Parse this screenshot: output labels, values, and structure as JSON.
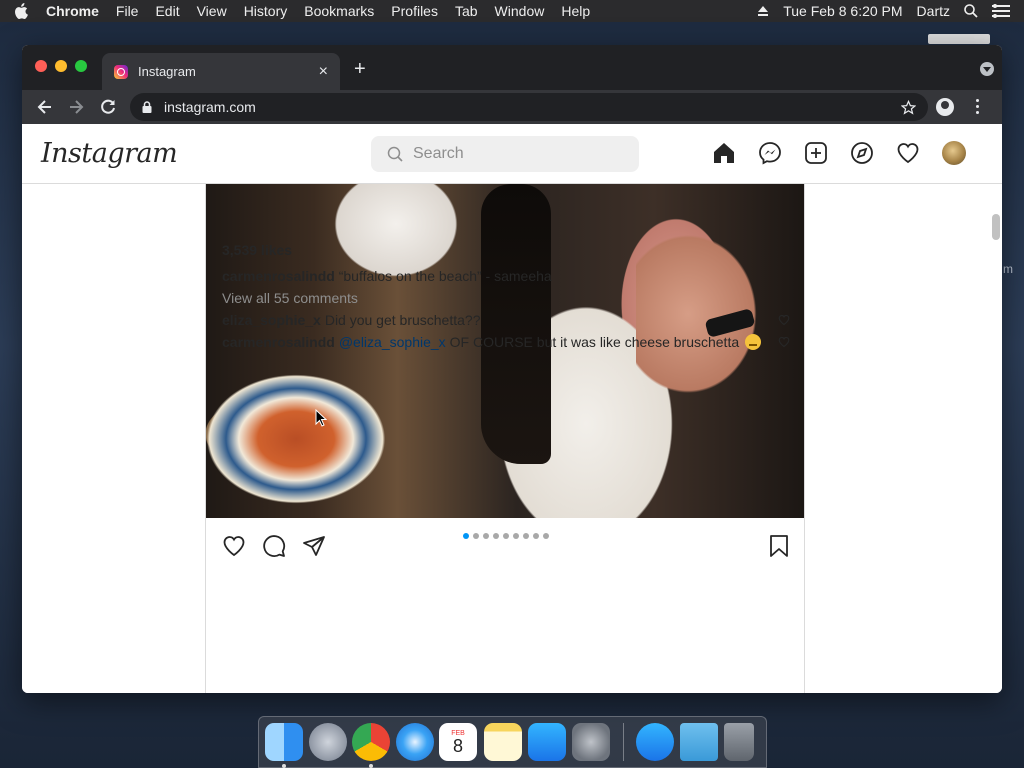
{
  "menubar": {
    "app_name": "Chrome",
    "items": [
      "File",
      "Edit",
      "View",
      "History",
      "Bookmarks",
      "Profiles",
      "Tab",
      "Window",
      "Help"
    ],
    "datetime": "Tue Feb 8  6:20 PM",
    "user": "Dartz"
  },
  "desktop": {
    "edge_text": "m"
  },
  "browser": {
    "tab_title": "Instagram",
    "tab_close": "×",
    "new_tab": "+",
    "url": "instagram.com"
  },
  "instagram": {
    "logo": "Instagram",
    "search_placeholder": "Search",
    "post": {
      "likes": "3,539 likes",
      "caption_user": "carmenrosalindd",
      "caption_text": "“buffalos on the beach” - sameeha",
      "view_all": "View all 55 comments",
      "carousel_count": 9,
      "carousel_active": 0,
      "comments": [
        {
          "user": "eliza_sophie_x",
          "mention": "",
          "text": "Did you get bruschetta??"
        },
        {
          "user": "carmenrosalindd",
          "mention": "@eliza_sophie_x",
          "text": "OF COURSE but it was like cheese bruschetta"
        }
      ]
    }
  },
  "dock": {
    "apps": [
      "Finder",
      "Launchpad",
      "Chrome",
      "Safari",
      "Calendar",
      "Notes",
      "App Store",
      "System Preferences",
      "App Store Utility",
      "Downloads",
      "Trash"
    ],
    "calendar_month": "FEB",
    "calendar_day": "8"
  },
  "colors": {
    "accent_blue": "#0095f6",
    "mention_blue": "#00376b",
    "chrome_dark": "#202124",
    "chrome_toolbar": "#35363a"
  }
}
